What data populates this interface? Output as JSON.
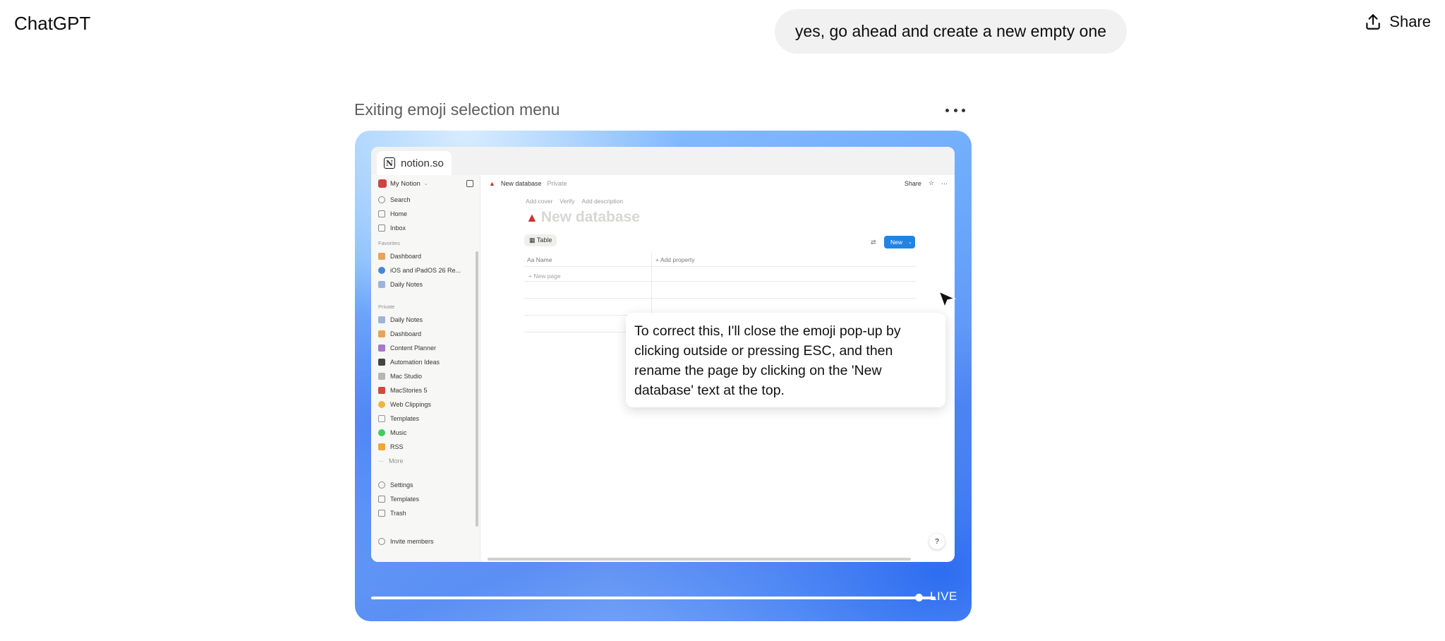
{
  "app": {
    "title": "ChatGPT",
    "share_label": "Share"
  },
  "user_message": "yes, go ahead and create a new empty one",
  "task": {
    "title": "Exiting emoji selection menu"
  },
  "browser": {
    "tab_label": "notion.so",
    "sidebar": {
      "workspace": "My Notion",
      "top_items": [
        "Search",
        "Home",
        "Inbox"
      ],
      "favorites_label": "Favorites",
      "favorites": [
        "Dashboard",
        "iOS and iPadOS 26 Re...",
        "Daily Notes"
      ],
      "private_label": "Private",
      "private_items": [
        "Daily Notes",
        "Dashboard",
        "Content Planner",
        "Automation Ideas",
        "Mac Studio",
        "MacStories 5",
        "Web Clippings",
        "Templates",
        "Music",
        "RSS",
        "More"
      ],
      "bottom_items": [
        "Settings",
        "Templates",
        "Trash"
      ],
      "invite": "Invite members"
    },
    "page": {
      "breadcrumb": "New database",
      "privacy": "Private",
      "share": "Share",
      "add_cover": "Add cover",
      "verify": "Verify",
      "add_description": "Add description",
      "title": "New database",
      "view_tab": "Table",
      "new_button": "New",
      "col_name": "Name",
      "add_property": "Add property",
      "new_page": "New page"
    },
    "tooltip": "To correct this, I'll close the emoji pop-up by clicking outside or pressing ESC, and then rename the page by clicking on the 'New database' text at the top."
  },
  "player": {
    "live_label": "LIVE",
    "progress": 0.99
  },
  "colors": {
    "accent": "#2383e2",
    "bubble": "#f1f1f1"
  }
}
